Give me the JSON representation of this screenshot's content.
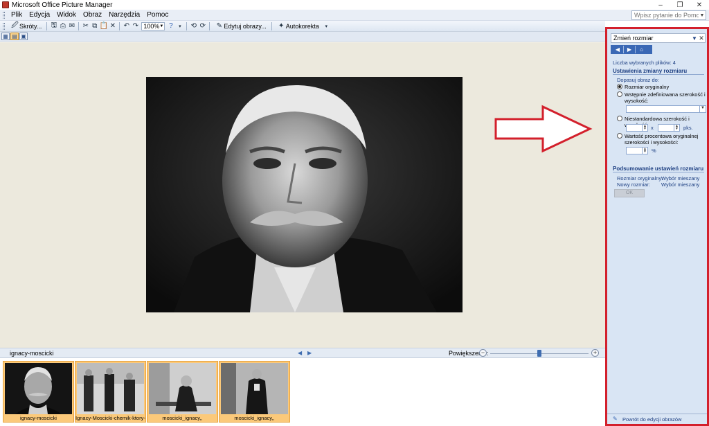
{
  "window": {
    "title": "Microsoft Office Picture Manager",
    "minimize": "–",
    "restore": "❐",
    "close": "✕"
  },
  "menu": {
    "items": [
      {
        "label": "Plik"
      },
      {
        "label": "Edycja"
      },
      {
        "label": "Widok"
      },
      {
        "label": "Obraz"
      },
      {
        "label": "Narzędzia"
      },
      {
        "label": "Pomoc"
      }
    ],
    "help_placeholder": "Wpisz pytanie do Pomocy"
  },
  "toolbar": {
    "shortcuts_label": "Skróty...",
    "zoom_value": "100%",
    "edit_label": "Edytuj obrazy...",
    "autocorrect_label": "Autokorekta"
  },
  "status": {
    "file_name": "ignacy-moscicki",
    "zoom_label": "Powiększenie:",
    "zoom_level": 0.5
  },
  "filmstrip": [
    {
      "label": "ignacy-moscicki"
    },
    {
      "label": "Ignacy-Moscicki-chemik-ktory-zo..."
    },
    {
      "label": "moscicki_ignacy,,"
    },
    {
      "label": "moscicki_ignacy,,"
    }
  ],
  "task_pane": {
    "title": "Zmień rozmiar",
    "selected_count": "Liczba wybranych plików: 4",
    "settings_heading": "Ustawienia zmiany rozmiaru",
    "fit_label": "Dopasuj obraz do:",
    "opt_original": "Rozmiar oryginalny",
    "opt_predefined": "Wstępnie zdefiniowana szerokość i wysokość:",
    "opt_custom": "Niestandardowa szerokość i wysokość:",
    "times": "x",
    "pixels": "pks.",
    "opt_percent": "Wartość procentowa oryginalnej szerokości i wysokości:",
    "percent": "%",
    "summary_heading": "Podsumowanie ustawień rozmiaru",
    "orig_size_label": "Rozmiar oryginalny:",
    "orig_size_value": "Wybór mieszany",
    "new_size_label": "Nowy rozmiar:",
    "new_size_value": "Wybór mieszany",
    "ok_label": "OK",
    "footer_link": "Powrót do edycji obrazów"
  },
  "colors": {
    "annotation_red": "#d3202c",
    "accent_blue": "#3a68b5",
    "thumb_selected": "#fbc97a"
  }
}
